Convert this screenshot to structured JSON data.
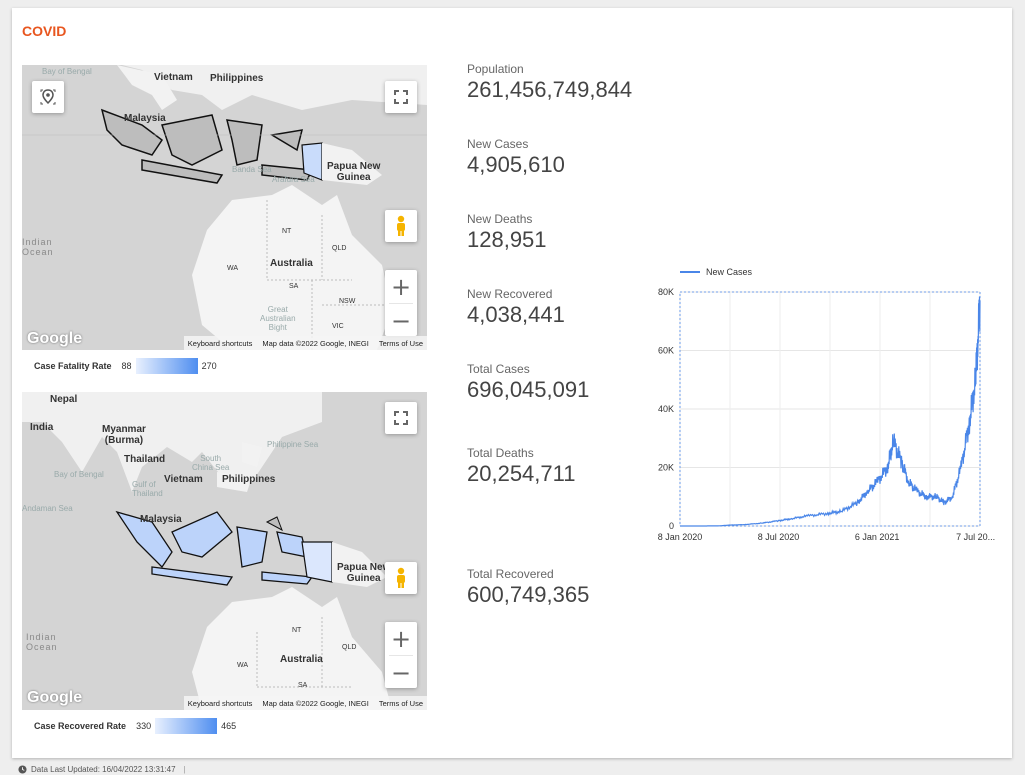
{
  "dashboard": {
    "title": "COVID"
  },
  "map1": {
    "labels": {
      "vietnam": "Vietnam",
      "philippines": "Philippines",
      "malaysia": "Malaysia",
      "png": "Papua New\nGuinea",
      "australia": "Australia",
      "nt": "NT",
      "qld": "QLD",
      "wa": "WA",
      "sa": "SA",
      "nsw": "NSW",
      "vic": "VIC",
      "gab": "Great\nAustralian\nBight",
      "indian_ocean": "Indian\nOcean",
      "bay": "Bay of Bengal",
      "gulf": "Gulf of\nThailand",
      "banda": "Banda Sea",
      "arafura": "Arafura Sea"
    },
    "attribution": {
      "shortcuts": "Keyboard shortcuts",
      "mapdata": "Map data ©2022 Google, INEGI",
      "terms": "Terms of Use"
    },
    "google": "Google",
    "legend": {
      "name": "Case Fatality Rate",
      "min": "88",
      "max": "270"
    }
  },
  "map2": {
    "labels": {
      "nepal": "Nepal",
      "india": "India",
      "myanmar": "Myanmar\n(Burma)",
      "thailand": "Thailand",
      "vietnam": "Vietnam",
      "philippines": "Philippines",
      "malaysia": "Malaysia",
      "png": "Papua New\nGuinea",
      "australia": "Australia",
      "nt": "NT",
      "qld": "QLD",
      "wa": "WA",
      "sa": "SA",
      "indian_ocean": "Indian\nOcean",
      "bay": "Bay of Bengal",
      "scs": "South\nChina Sea",
      "philsea": "Philippine Sea",
      "gulf": "Gulf of\nThailand",
      "andaman": "Andaman Sea"
    },
    "attribution": {
      "shortcuts": "Keyboard shortcuts",
      "mapdata": "Map data ©2022 Google, INEGI",
      "terms": "Terms of Use"
    },
    "google": "Google",
    "legend": {
      "name": "Case Recovered Rate",
      "min": "330",
      "max": "465"
    }
  },
  "kpis": [
    {
      "label": "Population",
      "value": "261,456,749,844"
    },
    {
      "label": "New Cases",
      "value": "4,905,610"
    },
    {
      "label": "New Deaths",
      "value": "128,951"
    },
    {
      "label": "New Recovered",
      "value": "4,038,441"
    },
    {
      "label": "Total Cases",
      "value": "696,045,091"
    },
    {
      "label": "Total Deaths",
      "value": "20,254,711"
    },
    {
      "label": "Total Recovered",
      "value": "600,749,365"
    }
  ],
  "chart_data": {
    "type": "line",
    "title": "",
    "xlabel": "",
    "ylabel": "",
    "series": [
      {
        "name": "New Cases",
        "color": "#4a86e8",
        "x": [
          "2020-01-08",
          "2020-02-15",
          "2020-03-20",
          "2020-04-08",
          "2020-05-08",
          "2020-06-08",
          "2020-07-08",
          "2020-08-01",
          "2020-09-01",
          "2020-10-07",
          "2020-11-01",
          "2020-12-01",
          "2020-12-20",
          "2021-01-06",
          "2021-01-25",
          "2021-02-05",
          "2021-02-20",
          "2021-03-05",
          "2021-03-20",
          "2021-04-07",
          "2021-04-25",
          "2021-05-10",
          "2021-05-25",
          "2021-06-10",
          "2021-06-25",
          "2021-07-07",
          "2021-07-15"
        ],
        "values": [
          0,
          0,
          50,
          300,
          500,
          1000,
          1800,
          2500,
          3500,
          4300,
          5000,
          8000,
          12000,
          15000,
          20000,
          29000,
          22000,
          15000,
          12000,
          10000,
          10000,
          8000,
          10000,
          20000,
          35000,
          50000,
          77000
        ]
      }
    ],
    "x_ticks_row1": [
      "8 Jan 2020",
      "8 Jul 2020",
      "6 Jan 2021",
      "7 Jul 20..."
    ],
    "x_ticks_row2": [
      "8 Apr 2020",
      "7 Oct 2020",
      "7 Apr 2021"
    ],
    "y_ticks": [
      "0",
      "20K",
      "40K",
      "60K",
      "80K"
    ],
    "ylim": [
      0,
      80000
    ],
    "legend_position": "top-left",
    "grid": true
  },
  "footer": {
    "last_updated": "Data Last Updated: 16/04/2022 13:31:47"
  }
}
